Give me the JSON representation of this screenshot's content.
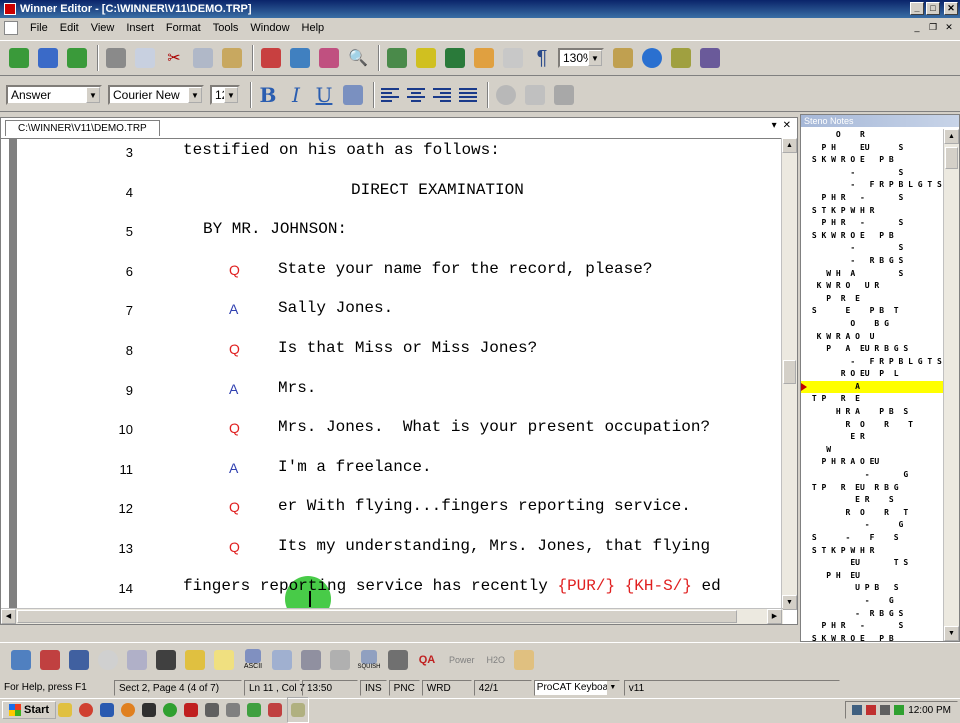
{
  "window": {
    "title": "Winner Editor - [C:\\WINNER\\V11\\DEMO.TRP]"
  },
  "menu": [
    "File",
    "Edit",
    "View",
    "Insert",
    "Format",
    "Tools",
    "Window",
    "Help"
  ],
  "toolbar": {
    "zoom": "130%",
    "paragraph_symbol": "¶"
  },
  "format_bar": {
    "style": "Answer",
    "font": "Courier New",
    "size": "12",
    "bold": "B",
    "italic": "I",
    "underline": "U"
  },
  "document": {
    "tab_label": "C:\\WINNER\\V11\\DEMO.TRP",
    "lines": [
      {
        "num": "3",
        "qa": "",
        "text": "testified on his oath as follows:",
        "indent": "full"
      },
      {
        "num": "4",
        "qa": "",
        "text": "DIRECT EXAMINATION",
        "indent": "center"
      },
      {
        "num": "5",
        "qa": "",
        "text": "BY MR. JOHNSON:",
        "indent": "by"
      },
      {
        "num": "6",
        "qa": "Q",
        "text": "State your name for the record, please?",
        "indent": "qa"
      },
      {
        "num": "7",
        "qa": "A",
        "text": "Sally Jones.",
        "indent": "qa"
      },
      {
        "num": "8",
        "qa": "Q",
        "text": "Is that Miss or Miss Jones?",
        "indent": "qa"
      },
      {
        "num": "9",
        "qa": "A",
        "text": "Mrs.",
        "indent": "qa"
      },
      {
        "num": "10",
        "qa": "Q",
        "text": "Mrs. Jones.  What is your present occupation?",
        "indent": "qa"
      },
      {
        "num": "11",
        "qa": "A",
        "text": "I'm a freelance.",
        "indent": "qa"
      },
      {
        "num": "12",
        "qa": "Q",
        "text": "er With flying...fingers reporting service.",
        "indent": "qa"
      },
      {
        "num": "13",
        "qa": "Q",
        "text": "Its my understanding, Mrs. Jones, that flying",
        "indent": "qa"
      },
      {
        "num": "14",
        "qa": "",
        "text": "fingers reporting service has recently ",
        "untrans1": "{PUR/}",
        "untrans2": "{KH-S/}",
        "tail": " ed",
        "indent": "full"
      }
    ]
  },
  "steno_notes": {
    "title": "Steno Notes",
    "rows": [
      "      O    R",
      "   P H     EU      S",
      " S K W R O E   P B",
      "         -         S",
      "         -   F R P B L G T S",
      "   P H R   -       S",
      " S T K P W H R",
      "   P H R   -       S",
      " S K W R O E   P B",
      "         -         S",
      "         -   R B G S",
      "    W H  A         S",
      "  K W R O   U R",
      "    P  R  E",
      " S      E    P B  T",
      "         O    B G",
      "  K W R A O  U",
      "    P   A  EU R B G S",
      "         -   F R P B L G T S",
      "       R O EU  P  L",
      "          A",
      " T P   R  E",
      "      H R A    P B  S",
      "        R  O    R    T",
      "         E R",
      "    W",
      "   P H R A O EU",
      "            -       G",
      " T P   R  EU  R B G",
      "          E R    S",
      "        R  O    R   T",
      "            -      G",
      " S      -    F    S",
      " S T K P W H R",
      "         EU       T S",
      "    P H  EU",
      "          U P B   S",
      "            -    G",
      "          -  R B G S",
      "   P H R   -       S",
      " S K W R O E   P B"
    ],
    "highlight_index": 20
  },
  "bottom_toolbar": {
    "power_label": "Power",
    "h2o_label": "H2O",
    "ascii_label": "ASCII",
    "squish_label": "SQUISH",
    "qa_label": "QA"
  },
  "status": {
    "help": "For Help, press F1",
    "section": "Sect 2, Page 4 (4 of 7)",
    "position": "Ln 11 , Col 7",
    "time": "13:50",
    "ins": "INS",
    "pnc": "PNC",
    "wrd": "WRD",
    "count": "42/1",
    "keyboard": "ProCAT Keyboard",
    "version": "v11"
  },
  "taskbar": {
    "start": "Start",
    "clock": "12:00 PM"
  },
  "colors": {
    "question": "#e02020",
    "answer": "#3040b0",
    "untranslate": "#e02020",
    "highlight": "#ffff00",
    "cursor_blob": "#3ec83e"
  }
}
